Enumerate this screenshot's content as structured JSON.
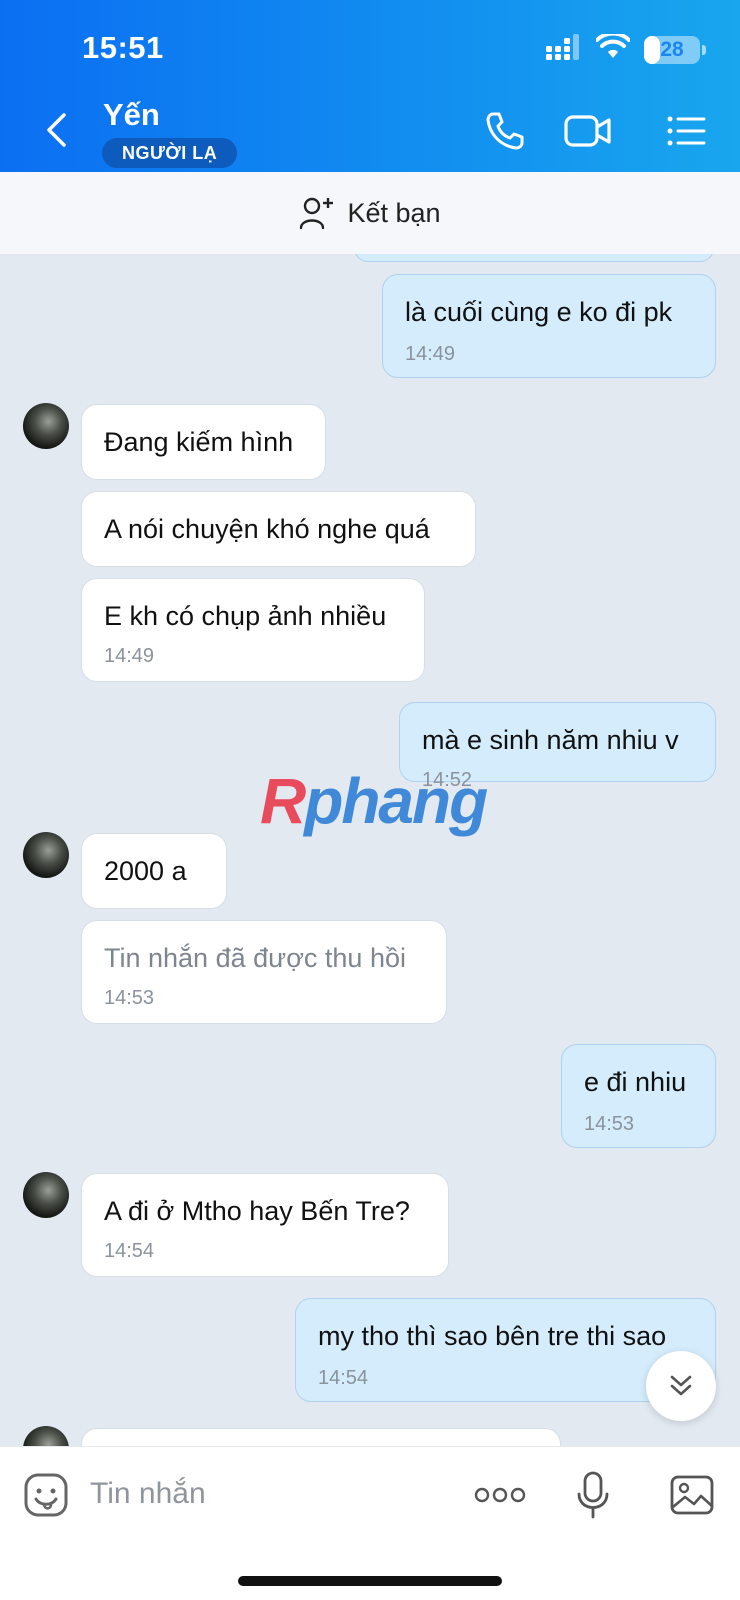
{
  "status_bar": {
    "time": "15:51",
    "battery": "28",
    "battery_level": 0.28
  },
  "header": {
    "contact_name": "Yến",
    "badge": "NGƯỜI LẠ",
    "icons": [
      "back-chevron-icon",
      "phone-icon",
      "video-call-icon",
      "menu-list-icon"
    ]
  },
  "add_friend": {
    "label": "Kết bạn",
    "icon": "add-user-icon"
  },
  "messages": [
    {
      "dir": "out",
      "text": "là cuối cùng e ko đi pk",
      "time": "14:49"
    },
    {
      "dir": "in",
      "text": "Đang kiếm hình",
      "time": ""
    },
    {
      "dir": "in",
      "text": "A nói chuyện khó nghe quá",
      "time": ""
    },
    {
      "dir": "in",
      "text": "E kh có chụp ảnh nhiều",
      "time": "14:49"
    },
    {
      "dir": "out",
      "text": "mà e sinh năm nhiu v",
      "time": "14:52"
    },
    {
      "dir": "in",
      "text": "2000 a",
      "time": ""
    },
    {
      "dir": "in",
      "text": "Tin nhắn đã được thu hồi",
      "time": "14:53",
      "recalled": true
    },
    {
      "dir": "out",
      "text": "e đi nhiu",
      "time": "14:53"
    },
    {
      "dir": "in",
      "text": "A đi ở Mtho hay Bến Tre?",
      "time": "14:54"
    },
    {
      "dir": "out",
      "text": "my tho thì sao bên tre thi sao",
      "time": "14:54"
    }
  ],
  "watermark": {
    "first": "R",
    "rest": "phang"
  },
  "input": {
    "placeholder": "Tin nhắn"
  },
  "colors": {
    "header_start": "#0b6ff2",
    "header_end": "#19a6ee",
    "out_bubble": "#d4ecfb",
    "chat_bg": "#e2e9f1"
  }
}
